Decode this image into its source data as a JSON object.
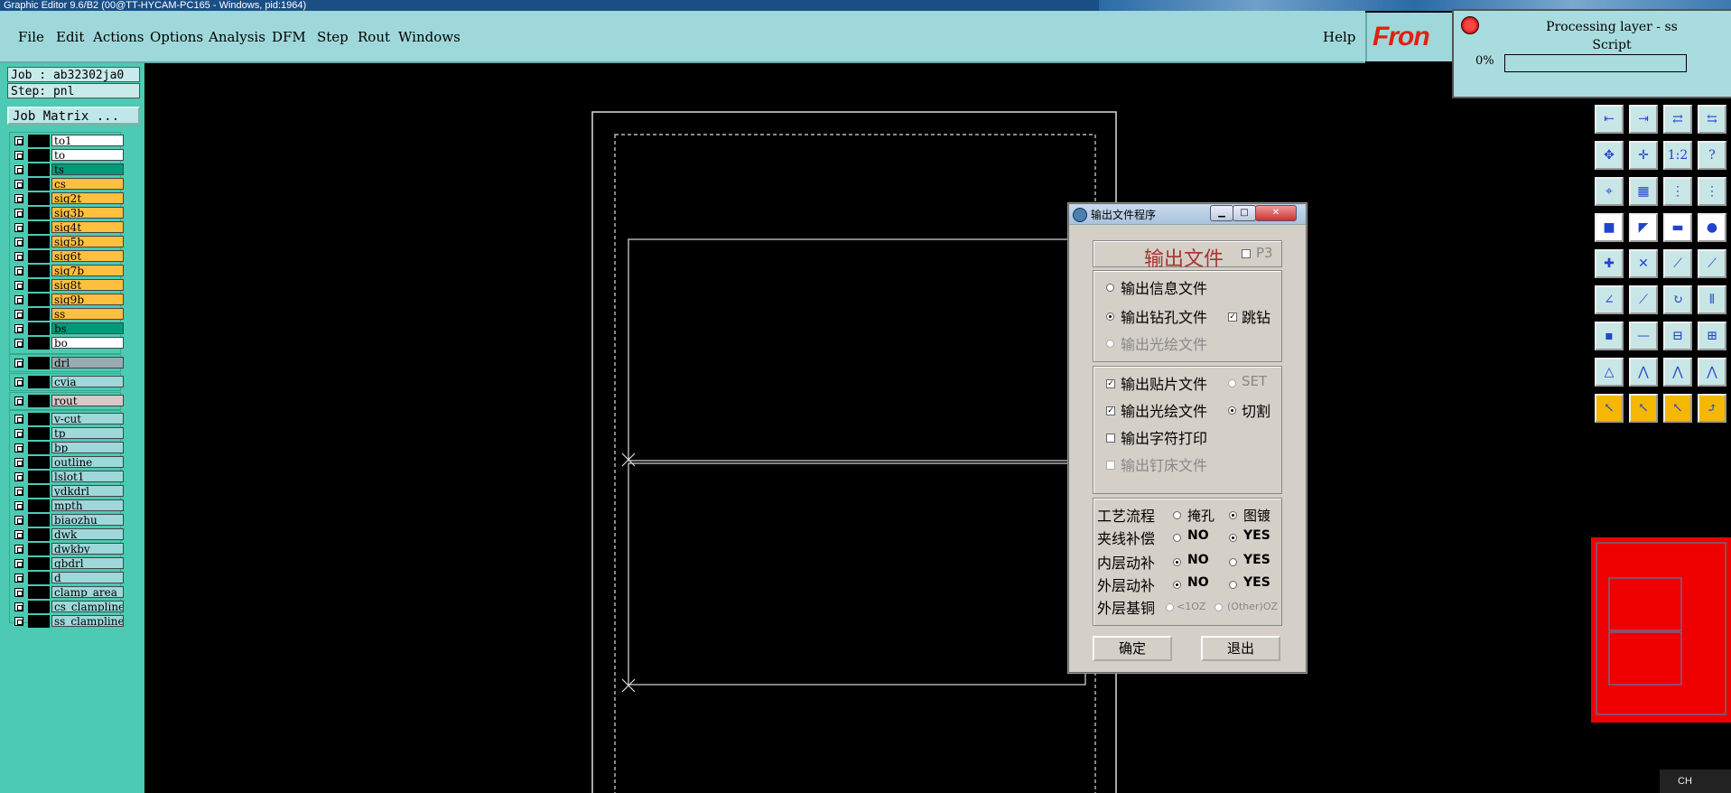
{
  "titlebar": {
    "text": "Graphic Editor 9.6/B2 (00@TT-HYCAM-PC165 - Windows, pid:1964)"
  },
  "menu": {
    "items": [
      "File",
      "Edit",
      "Actions",
      "Options",
      "Analysis",
      "DFM",
      "Step",
      "Rout",
      "Windows"
    ],
    "help": "Help"
  },
  "logo": {
    "text": "Fron"
  },
  "processing": {
    "title": "Processing layer - ss",
    "subtitle": "Script",
    "percent_label": "0%",
    "progress": 0
  },
  "job": {
    "job_label": "Job : ab32302ja0",
    "step_label": "Step: pnl",
    "matrix_button": "Job Matrix ..."
  },
  "layers": {
    "group1": [
      {
        "name": "to1",
        "color": "#ffffff"
      },
      {
        "name": "to",
        "color": "#ffffff"
      },
      {
        "name": "ts",
        "color": "#009a7a"
      },
      {
        "name": "cs",
        "color": "#ffc040"
      },
      {
        "name": "sig2t",
        "color": "#ffc040"
      },
      {
        "name": "sig3b",
        "color": "#ffc040"
      },
      {
        "name": "sig4t",
        "color": "#ffc040"
      },
      {
        "name": "sig5b",
        "color": "#ffc040"
      },
      {
        "name": "sig6t",
        "color": "#ffc040"
      },
      {
        "name": "sig7b",
        "color": "#ffc040"
      },
      {
        "name": "sig8t",
        "color": "#ffc040"
      },
      {
        "name": "sig9b",
        "color": "#ffc040"
      },
      {
        "name": "ss",
        "color": "#ffc040"
      },
      {
        "name": "bs",
        "color": "#009a7a"
      },
      {
        "name": "bo",
        "color": "#ffffff"
      }
    ],
    "drl": {
      "name": "drl",
      "color": "#9aaab2"
    },
    "cvia": {
      "name": "cvia",
      "color": "#9fd8da"
    },
    "rout": {
      "name": "rout",
      "color": "#d8c8c8"
    },
    "group2": [
      {
        "name": "v-cut",
        "color": "#9fd8da"
      },
      {
        "name": "tp",
        "color": "#9fd8da"
      },
      {
        "name": "bp",
        "color": "#9fd8da"
      },
      {
        "name": "outline",
        "color": "#9fd8da"
      },
      {
        "name": "lslot1",
        "color": "#9fd8da"
      },
      {
        "name": "ydkdrl",
        "color": "#9fd8da"
      },
      {
        "name": "mpth",
        "color": "#9fd8da"
      },
      {
        "name": "biaozhu",
        "color": "#9fd8da"
      },
      {
        "name": "dwk",
        "color": "#9fd8da"
      },
      {
        "name": "dwkby",
        "color": "#9fd8da"
      },
      {
        "name": "gbdrl",
        "color": "#9fd8da"
      },
      {
        "name": "d",
        "color": "#9fd8da"
      },
      {
        "name": "clamp_area",
        "color": "#9fd8da"
      },
      {
        "name": "cs_clampline",
        "color": "#9fd8da"
      },
      {
        "name": "ss_clampline",
        "color": "#9fd8da"
      }
    ]
  },
  "dialog": {
    "title": "输出文件程序",
    "heading": "输出文件",
    "p3": "P3",
    "opt_info": "输出信息文件",
    "opt_drill": "输出钻孔文件",
    "opt_jump": "跳钻",
    "opt_gerber": "输出光绘文件",
    "chk_smt": "输出贴片文件",
    "set_label": "SET",
    "chk_gerber": "输出光绘文件",
    "cut_label": "切割",
    "chk_char": "输出字符打印",
    "chk_nail": "输出钉床文件",
    "row_process": "工艺流程",
    "opt_mask": "掩孔",
    "opt_plate": "图镀",
    "row_clamp": "夹线补偿",
    "row_inner": "内层动补",
    "row_outer": "外层动补",
    "row_base": "外层基铜",
    "no": "NO",
    "yes": "YES",
    "lt1oz": "<1OZ",
    "other_oz": "(Other)OZ",
    "ok": "确定",
    "exit": "退出"
  },
  "taskbar": {
    "lang": "CH"
  }
}
